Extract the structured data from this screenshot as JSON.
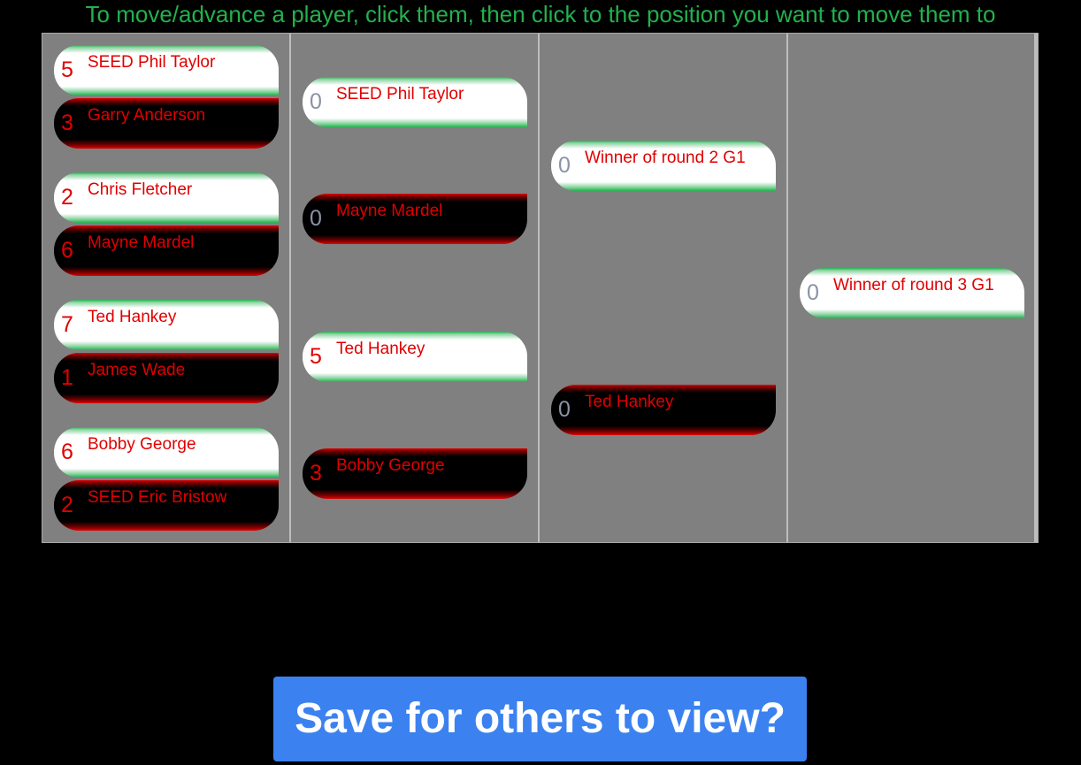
{
  "instructions": "To move/advance a player, click them, then click to the position you want to move them to",
  "save_button": "Save for others to view?",
  "colors": {
    "instruction_text": "#22b14c",
    "player_name": "#e00000",
    "bracket_bg": "#808080",
    "save_button_bg": "#3b82f0"
  },
  "rounds": [
    {
      "slots": [
        {
          "score": "5",
          "name": "SEED Phil Taylor",
          "style": "white"
        },
        {
          "score": "3",
          "name": "Garry Anderson",
          "style": "black"
        },
        {
          "score": "2",
          "name": "Chris Fletcher",
          "style": "white"
        },
        {
          "score": "6",
          "name": "Mayne Mardel",
          "style": "black"
        },
        {
          "score": "7",
          "name": "Ted Hankey",
          "style": "white"
        },
        {
          "score": "1",
          "name": "James Wade",
          "style": "black"
        },
        {
          "score": "6",
          "name": "Bobby George",
          "style": "white"
        },
        {
          "score": "2",
          "name": "SEED Eric Bristow",
          "style": "black"
        }
      ]
    },
    {
      "slots": [
        {
          "score": "0",
          "name": "SEED Phil Taylor",
          "style": "white"
        },
        {
          "score": "0",
          "name": "Mayne Mardel",
          "style": "black"
        },
        {
          "score": "5",
          "name": "Ted Hankey",
          "style": "white"
        },
        {
          "score": "3",
          "name": "Bobby George",
          "style": "black"
        }
      ]
    },
    {
      "slots": [
        {
          "score": "0",
          "name": "Winner of round 2 G1",
          "style": "white"
        },
        {
          "score": "0",
          "name": "Ted Hankey",
          "style": "black"
        }
      ]
    },
    {
      "slots": [
        {
          "score": "0",
          "name": "Winner of round 3 G1",
          "style": "white"
        }
      ]
    }
  ]
}
